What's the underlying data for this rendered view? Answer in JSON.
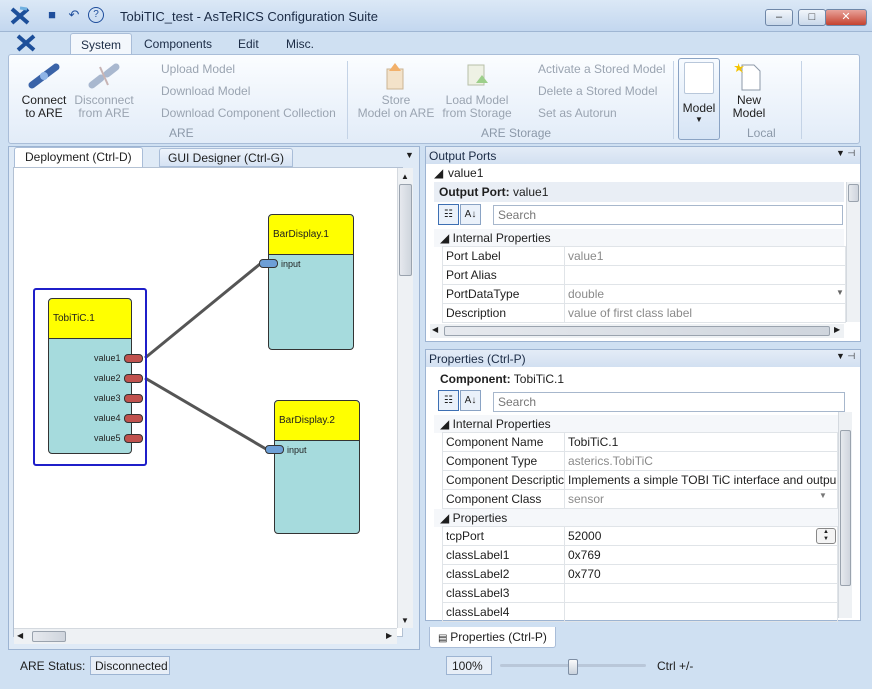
{
  "window": {
    "title": "TobiTIC_test - AsTeRICS Configuration Suite",
    "controls": [
      "–",
      "□",
      "✕"
    ]
  },
  "quick_access": [
    "■",
    "↶",
    "?"
  ],
  "ribbon_tabs": [
    "System",
    "Components",
    "Edit",
    "Misc."
  ],
  "ribbon": {
    "connect": [
      "Connect",
      "to ARE"
    ],
    "disconnect": [
      "Disconnect",
      "from ARE"
    ],
    "are_links": [
      "Upload Model",
      "Download Model",
      "Download Component Collection"
    ],
    "are_group": "ARE",
    "store": [
      "Store",
      "Model on ARE"
    ],
    "load": [
      "Load Model",
      "from Storage"
    ],
    "storage_links": [
      "Activate a Stored Model",
      "Delete a Stored Model",
      "Set as Autorun"
    ],
    "storage_group": "ARE Storage",
    "model": "Model",
    "new_model": [
      "New",
      "Model"
    ],
    "local_group": "Local"
  },
  "canvas_tabs": [
    "Deployment (Ctrl-D)",
    "GUI Designer (Ctrl-G)"
  ],
  "components": {
    "tobitic": {
      "name": "TobiTiC.1",
      "ports": [
        "value1",
        "value2",
        "value3",
        "value4",
        "value5"
      ]
    },
    "bar1": {
      "name": "BarDisplay.1",
      "port": "input"
    },
    "bar2": {
      "name": "BarDisplay.2",
      "port": "input"
    }
  },
  "output_ports": {
    "title": "Output Ports",
    "selected": "value1",
    "header_label": "Output Port:",
    "header_value": "value1",
    "search_placeholder": "Search",
    "section": "Internal Properties",
    "rows": [
      [
        "Port Label",
        "value1"
      ],
      [
        "Port Alias",
        ""
      ],
      [
        "PortDataType",
        "double"
      ],
      [
        "Description",
        "value of first class label"
      ]
    ]
  },
  "properties": {
    "title": "Properties (Ctrl-P)",
    "header_label": "Component:",
    "header_value": "TobiTiC.1",
    "search_placeholder": "Search",
    "internal_section": "Internal Properties",
    "internal_rows": [
      [
        "Component Name",
        "TobiTiC.1"
      ],
      [
        "Component Type",
        "asterics.TobiTiC"
      ],
      [
        "Component Descriptic",
        "Implements a simple TOBI TiC  interface and outpu"
      ],
      [
        "Component Class",
        "sensor"
      ]
    ],
    "props_section": "Properties",
    "props_rows": [
      [
        "tcpPort",
        "52000"
      ],
      [
        "classLabel1",
        "0x769"
      ],
      [
        "classLabel2",
        "0x770"
      ],
      [
        "classLabel3",
        ""
      ],
      [
        "classLabel4",
        ""
      ]
    ],
    "bottom_tab": "Properties (Ctrl-P)"
  },
  "status": {
    "are_label": "ARE Status:",
    "are_value": "Disconnected",
    "zoom": "100%",
    "zoom_fraction": 0.5,
    "zoom_hint": "Ctrl +/-"
  }
}
